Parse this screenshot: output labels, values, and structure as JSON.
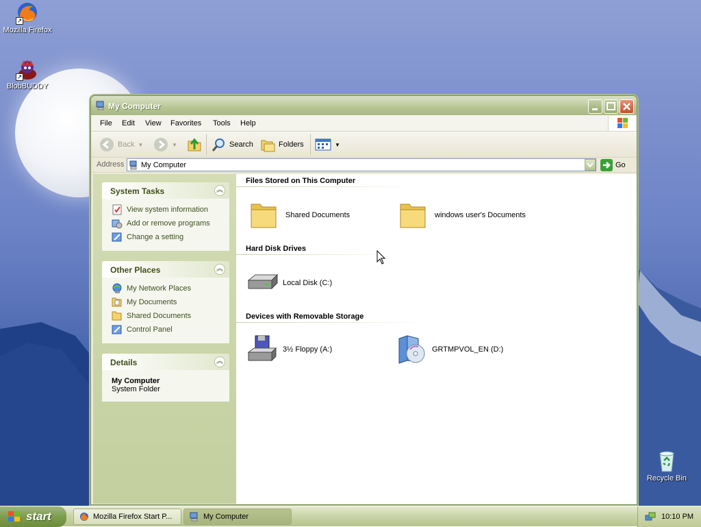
{
  "desktop": {
    "icons": [
      {
        "label": "Mozilla Firefox"
      },
      {
        "label": "BlobBUDDY"
      },
      {
        "label": "Recycle Bin"
      }
    ]
  },
  "window": {
    "title": "My Computer",
    "menu": [
      "File",
      "Edit",
      "View",
      "Favorites",
      "Tools",
      "Help"
    ],
    "toolbar": {
      "back_label": "Back",
      "search_label": "Search",
      "folders_label": "Folders"
    },
    "address": {
      "label": "Address",
      "value": "My Computer",
      "go_label": "Go"
    },
    "sidebar": {
      "system_tasks": {
        "title": "System Tasks",
        "items": [
          "View system information",
          "Add or remove programs",
          "Change a setting"
        ]
      },
      "other_places": {
        "title": "Other Places",
        "items": [
          "My Network Places",
          "My Documents",
          "Shared Documents",
          "Control Panel"
        ]
      },
      "details": {
        "title": "Details",
        "name": "My Computer",
        "type": "System Folder"
      }
    },
    "content": {
      "groups": [
        {
          "title": "Files Stored on This Computer",
          "items": [
            "Shared Documents",
            "windows user's Documents"
          ]
        },
        {
          "title": "Hard Disk Drives",
          "items": [
            "Local Disk (C:)"
          ]
        },
        {
          "title": "Devices with Removable Storage",
          "items": [
            "3½ Floppy (A:)",
            "GRTMPVOL_EN (D:)"
          ]
        }
      ]
    }
  },
  "taskbar": {
    "start_label": "start",
    "tasks": [
      "Mozilla Firefox Start P...",
      "My Computer"
    ],
    "clock": "10:10 PM"
  },
  "colors": {
    "window_frame": "#a9b985",
    "sidebar_bg": "#c3cf9e",
    "link_text": "#3d5020",
    "taskbar": "#cbd5aa"
  }
}
